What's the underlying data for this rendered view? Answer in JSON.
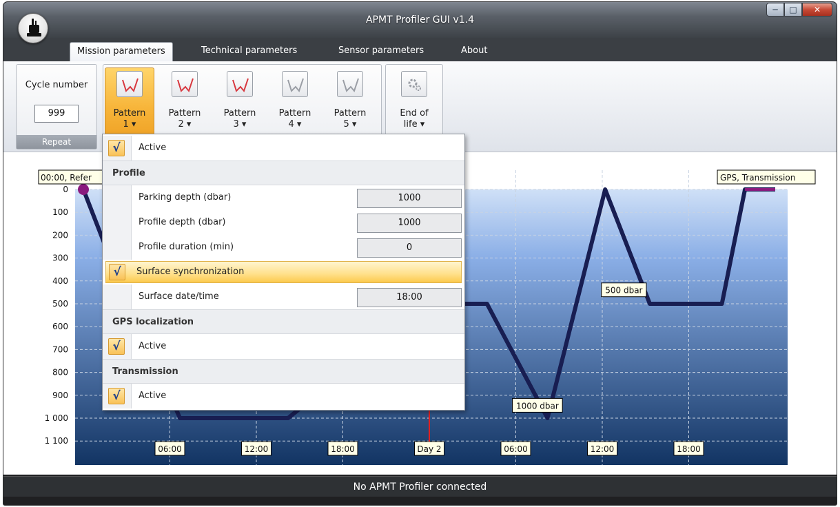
{
  "window": {
    "title": "APMT Profiler GUI v1.4"
  },
  "tabs": [
    {
      "label": "Mission parameters",
      "active": true
    },
    {
      "label": "Technical parameters",
      "active": false
    },
    {
      "label": "Sensor parameters",
      "active": false
    },
    {
      "label": "About",
      "active": false
    }
  ],
  "ribbon": {
    "repeat_group": {
      "caption": "Cycle number",
      "value": "999",
      "label": "Repeat"
    },
    "patterns": [
      {
        "line1": "Pattern",
        "line2": "1 ▾",
        "active": true,
        "color": "#d8383f"
      },
      {
        "line1": "Pattern",
        "line2": "2 ▾",
        "active": false,
        "color": "#d8383f"
      },
      {
        "line1": "Pattern",
        "line2": "3 ▾",
        "active": false,
        "color": "#d8383f"
      },
      {
        "line1": "Pattern",
        "line2": "4 ▾",
        "active": false,
        "color": "#9a9ea5"
      },
      {
        "line1": "Pattern",
        "line2": "5 ▾",
        "active": false,
        "color": "#9a9ea5"
      }
    ],
    "end_of_life": {
      "line1": "End of",
      "line2": "life ▾"
    }
  },
  "dropdown": {
    "active_label": "Active",
    "profile_header": "Profile",
    "parking_depth_label": "Parking depth (dbar)",
    "parking_depth_value": "1000",
    "profile_depth_label": "Profile depth (dbar)",
    "profile_depth_value": "1000",
    "profile_duration_label": "Profile duration (min)",
    "profile_duration_value": "0",
    "surface_sync_label": "Surface synchronization",
    "surface_datetime_label": "Surface date/time",
    "surface_datetime_value": "18:00",
    "gps_header": "GPS localization",
    "gps_active_label": "Active",
    "transmission_header": "Transmission",
    "transmission_active_label": "Active",
    "check_glyph": "√"
  },
  "chart_data": {
    "type": "line",
    "title": "",
    "y_ticks": [
      0,
      100,
      200,
      300,
      400,
      500,
      600,
      700,
      800,
      900,
      1000,
      1100
    ],
    "y_tick_labels": [
      "0",
      "100",
      "200",
      "300",
      "400",
      "500",
      "600",
      "700",
      "800",
      "900",
      "1 000",
      "1 100"
    ],
    "ylim": [
      0,
      1100
    ],
    "y_inverted": true,
    "x_range_hours": [
      0,
      48
    ],
    "x_tick_hours": [
      6,
      12,
      18,
      24,
      30,
      36,
      42
    ],
    "x_tick_labels": [
      "06:00",
      "12:00",
      "18:00",
      "Day 2",
      "06:00",
      "12:00",
      "18:00"
    ],
    "day_marker_hour": 24,
    "top_labels": {
      "left": "00:00, Refer",
      "right": "GPS, Transmission"
    },
    "profile_x_hours": [
      0,
      1.6,
      6.7,
      14.2,
      24,
      28,
      32.2,
      36.2,
      39.3,
      44.3,
      45.9,
      48
    ],
    "profile_depth_dbar": [
      0,
      260,
      1000,
      1000,
      500,
      500,
      1000,
      0,
      500,
      500,
      0,
      0
    ],
    "annotations": [
      {
        "text": "1000 dbar",
        "x_hour": 31.5,
        "depth": 950
      },
      {
        "text": "500 dbar",
        "x_hour": 37.5,
        "depth": 445
      }
    ],
    "colors": {
      "line": "#181e52",
      "start_marker": "#8a1a7e",
      "end_marker": "#8a1a7e",
      "day_marker": "#e02020",
      "gradient_top": "#cfe0f7",
      "gradient_bottom": "#123463"
    }
  },
  "status": {
    "text": "No APMT Profiler connected"
  }
}
